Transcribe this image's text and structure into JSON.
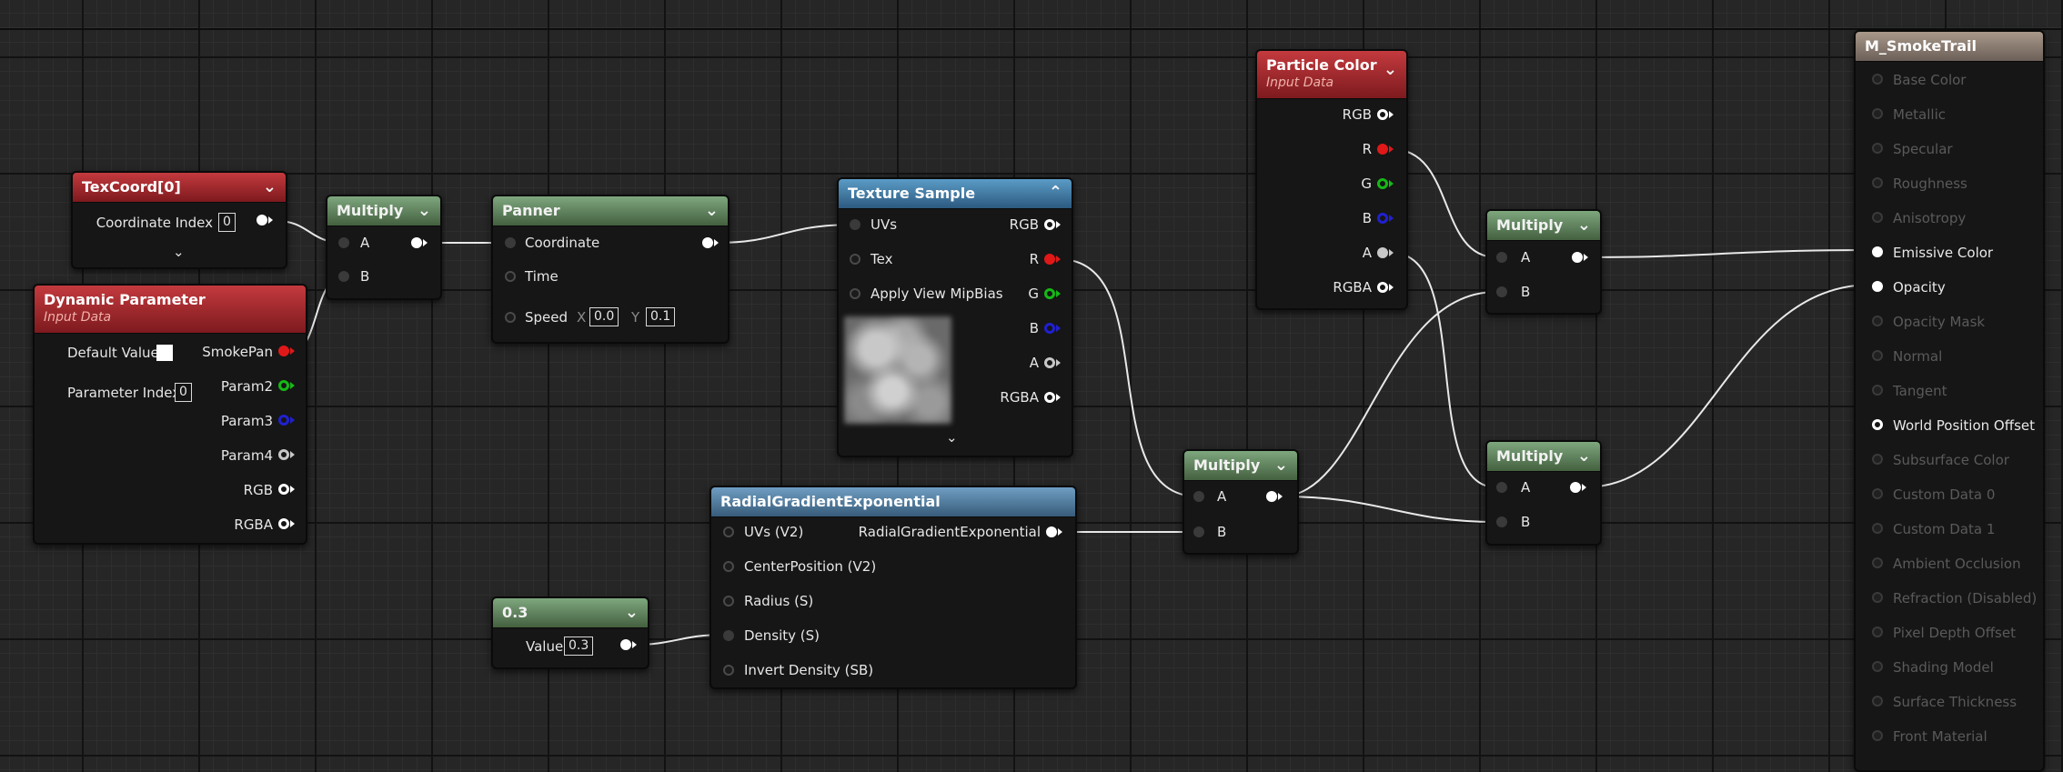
{
  "colors": {
    "wire": "#e8e8e8",
    "grid": "#262626",
    "header_red": "#a02a2e",
    "header_green": "#5e805a",
    "header_blue": "#3f7aa8"
  },
  "nodes": {
    "texcoord": {
      "title": "TexCoord[0]",
      "coord_index_label": "Coordinate Index",
      "coord_index_value": "0"
    },
    "dynparam": {
      "title": "Dynamic Parameter",
      "subtitle": "Input Data",
      "default_value_label": "Default Value",
      "param_index_label": "Parameter Index",
      "param_index_value": "0",
      "outputs": [
        "SmokePan",
        "Param2",
        "Param3",
        "Param4",
        "RGB",
        "RGBA"
      ]
    },
    "multiply1": {
      "title": "Multiply",
      "a": "A",
      "b": "B"
    },
    "panner": {
      "title": "Panner",
      "coordinate": "Coordinate",
      "time": "Time",
      "speed": "Speed",
      "x_label": "X",
      "x_value": "0.0",
      "y_label": "Y",
      "y_value": "0.1"
    },
    "texsample": {
      "title": "Texture Sample",
      "inputs": [
        "UVs",
        "Tex",
        "Apply View MipBias"
      ],
      "outputs": [
        "RGB",
        "R",
        "G",
        "B",
        "A",
        "RGBA"
      ]
    },
    "particlecolor": {
      "title": "Particle Color",
      "subtitle": "Input Data",
      "outputs": [
        "RGB",
        "R",
        "G",
        "B",
        "A",
        "RGBA"
      ]
    },
    "radial": {
      "title": "RadialGradientExponential",
      "inputs": [
        "UVs (V2)",
        "CenterPosition (V2)",
        "Radius (S)",
        "Density (S)",
        "Invert Density (SB)"
      ],
      "output": "RadialGradientExponential"
    },
    "constant": {
      "title": "0.3",
      "value_label": "Value",
      "value": "0.3"
    },
    "multiply2": {
      "title": "Multiply",
      "a": "A",
      "b": "B"
    },
    "multiply3": {
      "title": "Multiply",
      "a": "A",
      "b": "B"
    },
    "multiply4": {
      "title": "Multiply",
      "a": "A",
      "b": "B"
    },
    "result": {
      "title": "M_SmokeTrail",
      "pins": [
        "Base Color",
        "Metallic",
        "Specular",
        "Roughness",
        "Anisotropy",
        "Emissive Color",
        "Opacity",
        "Opacity Mask",
        "Normal",
        "Tangent",
        "World Position Offset",
        "Subsurface Color",
        "Custom Data 0",
        "Custom Data 1",
        "Ambient Occlusion",
        "Refraction (Disabled)",
        "Pixel Depth Offset",
        "Shading Model",
        "Surface Thickness",
        "Front Material"
      ]
    }
  }
}
